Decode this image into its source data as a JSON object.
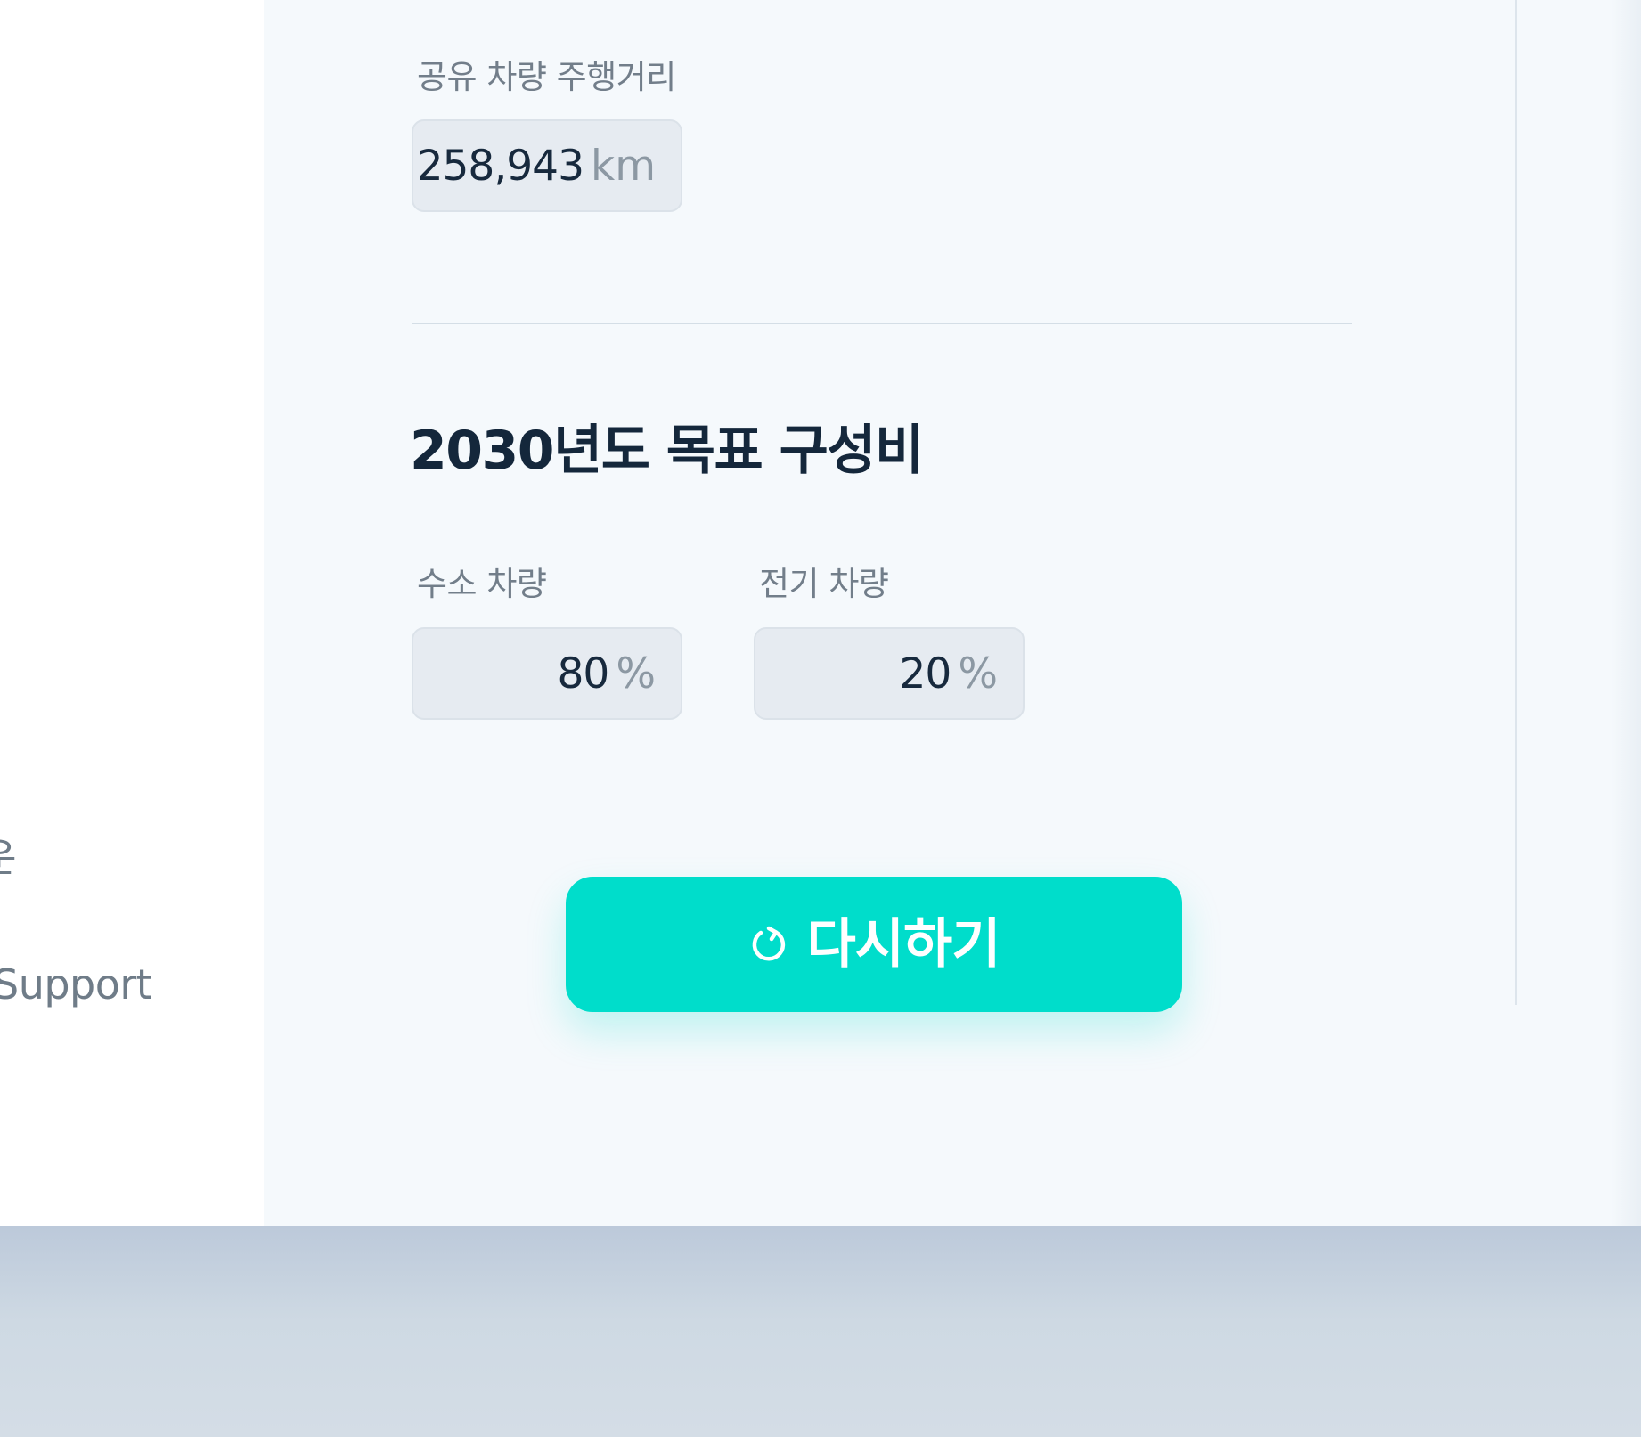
{
  "sidebar": {
    "partial_char": "운",
    "support_label": "Support"
  },
  "shared_mileage": {
    "label": "공유 차량 주행거리",
    "value": "258,943",
    "unit": "km"
  },
  "target_section": {
    "title": "2030년도 목표 구성비",
    "hydrogen": {
      "label": "수소 차량",
      "value": "80",
      "unit": "%"
    },
    "electric": {
      "label": "전기 차량",
      "value": "20",
      "unit": "%"
    }
  },
  "retry_button": {
    "icon": "refresh-icon",
    "label": "다시하기"
  },
  "colors": {
    "accent": "#00ddcb",
    "title": "#14273b",
    "label": "#727e8a",
    "panel": "#f5f9fc",
    "field": "#e6ebf1"
  }
}
